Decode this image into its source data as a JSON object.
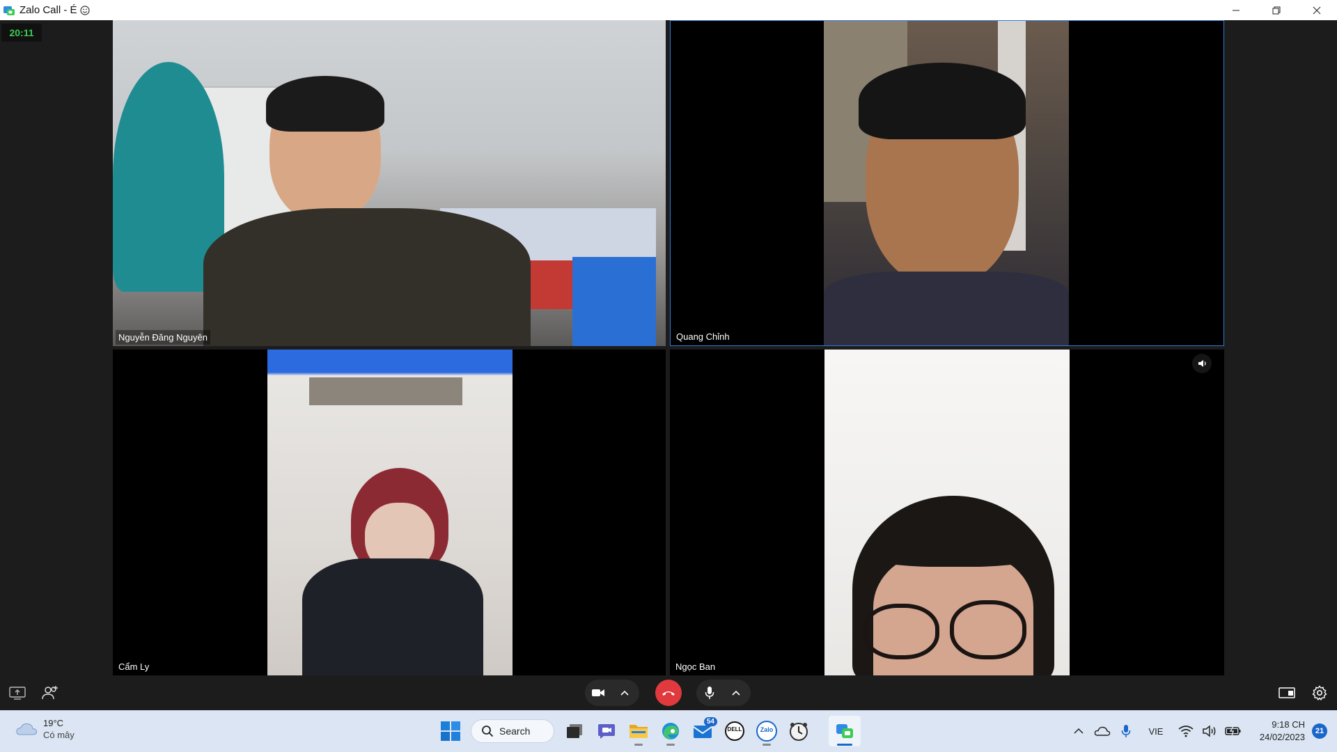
{
  "window": {
    "title": "Zalo Call - É",
    "controls": [
      "minimize",
      "restore",
      "close"
    ]
  },
  "call": {
    "timer": "20:11",
    "participants": [
      {
        "name": "Nguyễn Đăng Nguyên"
      },
      {
        "name": "Quang Chỉnh"
      },
      {
        "name": "Cẩm Ly"
      },
      {
        "name": "Ngọc Ban"
      }
    ]
  },
  "controls": {
    "icons": [
      "share-screen-icon",
      "add-member-icon",
      "camera-icon",
      "chevron-up-icon",
      "hang-up-icon",
      "microphone-icon",
      "chevron-up-icon",
      "layout-icon",
      "settings-icon"
    ]
  },
  "taskbar": {
    "weather": {
      "temp": "19°C",
      "condition": "Có mây"
    },
    "search_label": "Search",
    "mail_badge": "54",
    "zalo_label": "Zalo",
    "dell_label": "DELL",
    "language": "VIE",
    "time": "9:18 CH",
    "date": "24/02/2023",
    "notifications": "21"
  },
  "colors": {
    "accent": "#2e7bd6",
    "timer": "#3ccc52",
    "hangup": "#e0393e",
    "taskbar": "#dbe5f3"
  }
}
